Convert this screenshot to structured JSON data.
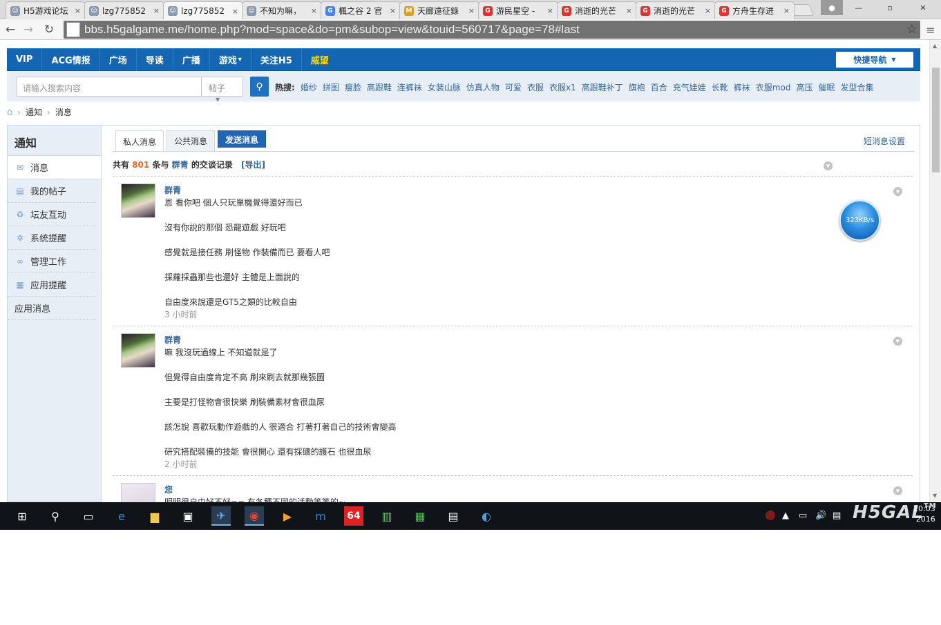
{
  "browser": {
    "tabs": [
      {
        "title": "H5游戏论坛",
        "fav_color": "#8a9bb0",
        "fav_glyph": "☺"
      },
      {
        "title": "lzg775852",
        "fav_color": "#8a9bb0",
        "fav_glyph": "☺"
      },
      {
        "title": "lzg775852",
        "fav_color": "#8a9bb0",
        "fav_glyph": "☺",
        "active": true
      },
      {
        "title": "不知为嘛，",
        "fav_color": "#8a9bb0",
        "fav_glyph": "☺"
      },
      {
        "title": "楓之谷 2 官",
        "fav_color": "#4285f4",
        "fav_glyph": "G"
      },
      {
        "title": "天廊遠征錄",
        "fav_color": "#d8a120",
        "fav_glyph": "M"
      },
      {
        "title": "游民星空 -",
        "fav_color": "#d33",
        "fav_glyph": "G"
      },
      {
        "title": "消逝的光芒",
        "fav_color": "#d33",
        "fav_glyph": "G"
      },
      {
        "title": "消逝的光芒",
        "fav_color": "#d33",
        "fav_glyph": "G"
      },
      {
        "title": "方舟生存进",
        "fav_color": "#d33",
        "fav_glyph": "G"
      }
    ],
    "close_glyph": "×",
    "url": "bbs.h5galgame.me/home.php?mod=space&do=pm&subop=view&touid=560717&page=78#last"
  },
  "topnav": {
    "items": [
      "VIP",
      "ACG情报",
      "广场",
      "导读",
      "广播",
      "游戏",
      "关注H5",
      "威望"
    ],
    "game_caret": "▾",
    "quick_nav": "快捷导航",
    "quick_caret": "▼"
  },
  "search": {
    "placeholder": "请输入搜索内容",
    "type": "帖子",
    "hot_label": "热搜:",
    "hot_words": [
      "婚纱",
      "拼图",
      "瘦脸",
      "高跟鞋",
      "连裤袜",
      "女装山脉",
      "仿真人物",
      "可爱",
      "衣服",
      "衣服x1",
      "高跟鞋补丁",
      "旗袍",
      "百合",
      "充气娃娃",
      "长靴",
      "裤袜",
      "衣服mod",
      "高压",
      "催眠",
      "发型合集"
    ]
  },
  "breadcrumb": {
    "home_icon": "home-icon",
    "items": [
      "通知",
      "消息"
    ],
    "sep": "›"
  },
  "sidebar": {
    "title": "通知",
    "items": [
      {
        "label": "消息",
        "icon": "mail-icon",
        "glyph": "✉",
        "active": true
      },
      {
        "label": "我的帖子",
        "icon": "document-icon",
        "glyph": "▤"
      },
      {
        "label": "坛友互动",
        "icon": "recycle-icon",
        "glyph": "♻"
      },
      {
        "label": "系统提醒",
        "icon": "gear-icon",
        "glyph": "✲"
      },
      {
        "label": "管理工作",
        "icon": "link-icon",
        "glyph": "∞"
      },
      {
        "label": "应用提醒",
        "icon": "grid-icon",
        "glyph": "▦"
      },
      {
        "label": "应用消息",
        "icon": "",
        "glyph": ""
      }
    ]
  },
  "main": {
    "tabs": [
      "私人消息",
      "公共消息",
      "发送消息"
    ],
    "settings_link": "短消息设置",
    "summary": {
      "prefix": "共有",
      "count": "801",
      "mid": "条与",
      "name": "群青",
      "suffix": "的交谈记录",
      "export": "[导出]"
    }
  },
  "messages": [
    {
      "sender": "群青",
      "lines": [
        "恩 看你吧  個人只玩單機覺得還好而已",
        "沒有你說的那個  恐龍遊戲  好玩吧",
        "感覺就是接任務  刷怪物  作裝備而已  要看人吧",
        "採蘿採蟲那些也還好  主體是上面說的",
        "自由度來說還是GT5之類的比較自由"
      ],
      "time": "3 小时前"
    },
    {
      "sender": "群青",
      "lines": [
        "嘛  我沒玩過線上 不知道就是了",
        "但覺得自由度肯定不高  刷來刷去就那幾張圖",
        "主要是打怪物會很快樂  刷裝備素材會很血尿",
        "該怎說 喜歡玩動作遊戲的人 很適合  打著打著自己的技術會變高",
        "研究搭配裝備的技能  會很開心  還有採礦的護石 也很血尿"
      ],
      "time": "2 小时前"
    },
    {
      "sender": "您",
      "lines": [
        "明明很自由好不好==  有各種不同的活動等等的~"
      ],
      "time": ""
    }
  ],
  "speed_widget": "323KB/s",
  "taskbar": {
    "items": [
      "start-icon",
      "search-icon",
      "task-view-icon",
      "edge-icon",
      "explorer-icon",
      "store-icon",
      "app-icon",
      "chrome-icon",
      "player-icon",
      "maxthon-icon",
      "sixty-four-icon",
      "books-icon",
      "chip-icon",
      "chart-icon",
      "globe-icon"
    ],
    "badge_64": "64",
    "logo_text": "H5GAL",
    "tm": "TM",
    "clock_time": "20:03",
    "clock_date": "2016"
  },
  "colors": {
    "nav_blue": "#1466b2",
    "accent_orange": "#e06a2a",
    "link_blue": "#336699"
  }
}
